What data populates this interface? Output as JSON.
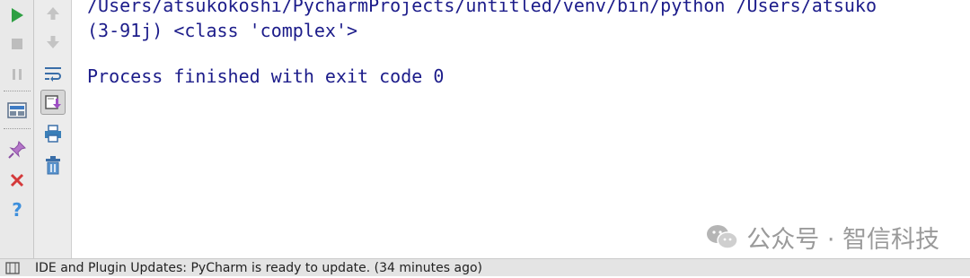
{
  "console": {
    "lines": [
      "/Users/atsukokoshi/PycharmProjects/untitled/venv/bin/python /Users/atsuko",
      "(3-91j) <class 'complex'>",
      "",
      "Process finished with exit code 0"
    ]
  },
  "status_bar": {
    "message": "IDE and Plugin Updates: PyCharm is ready to update. (34 minutes ago)"
  },
  "watermark": {
    "text": "公众号 · 智信科技"
  },
  "icons": {
    "left_toolbar": [
      "run-icon",
      "stop-icon",
      "pause-icon",
      "layout-icon",
      "pin-icon",
      "close-icon",
      "help-icon"
    ],
    "right_toolbar": [
      "up-arrow-icon",
      "down-arrow-icon",
      "soft-wrap-icon",
      "scroll-to-end-icon",
      "print-icon",
      "trash-icon"
    ]
  },
  "colors": {
    "console_text": "#1c1c8a",
    "run_green": "#2ea043",
    "close_red": "#d4393a",
    "help_blue": "#3d8fdc"
  }
}
